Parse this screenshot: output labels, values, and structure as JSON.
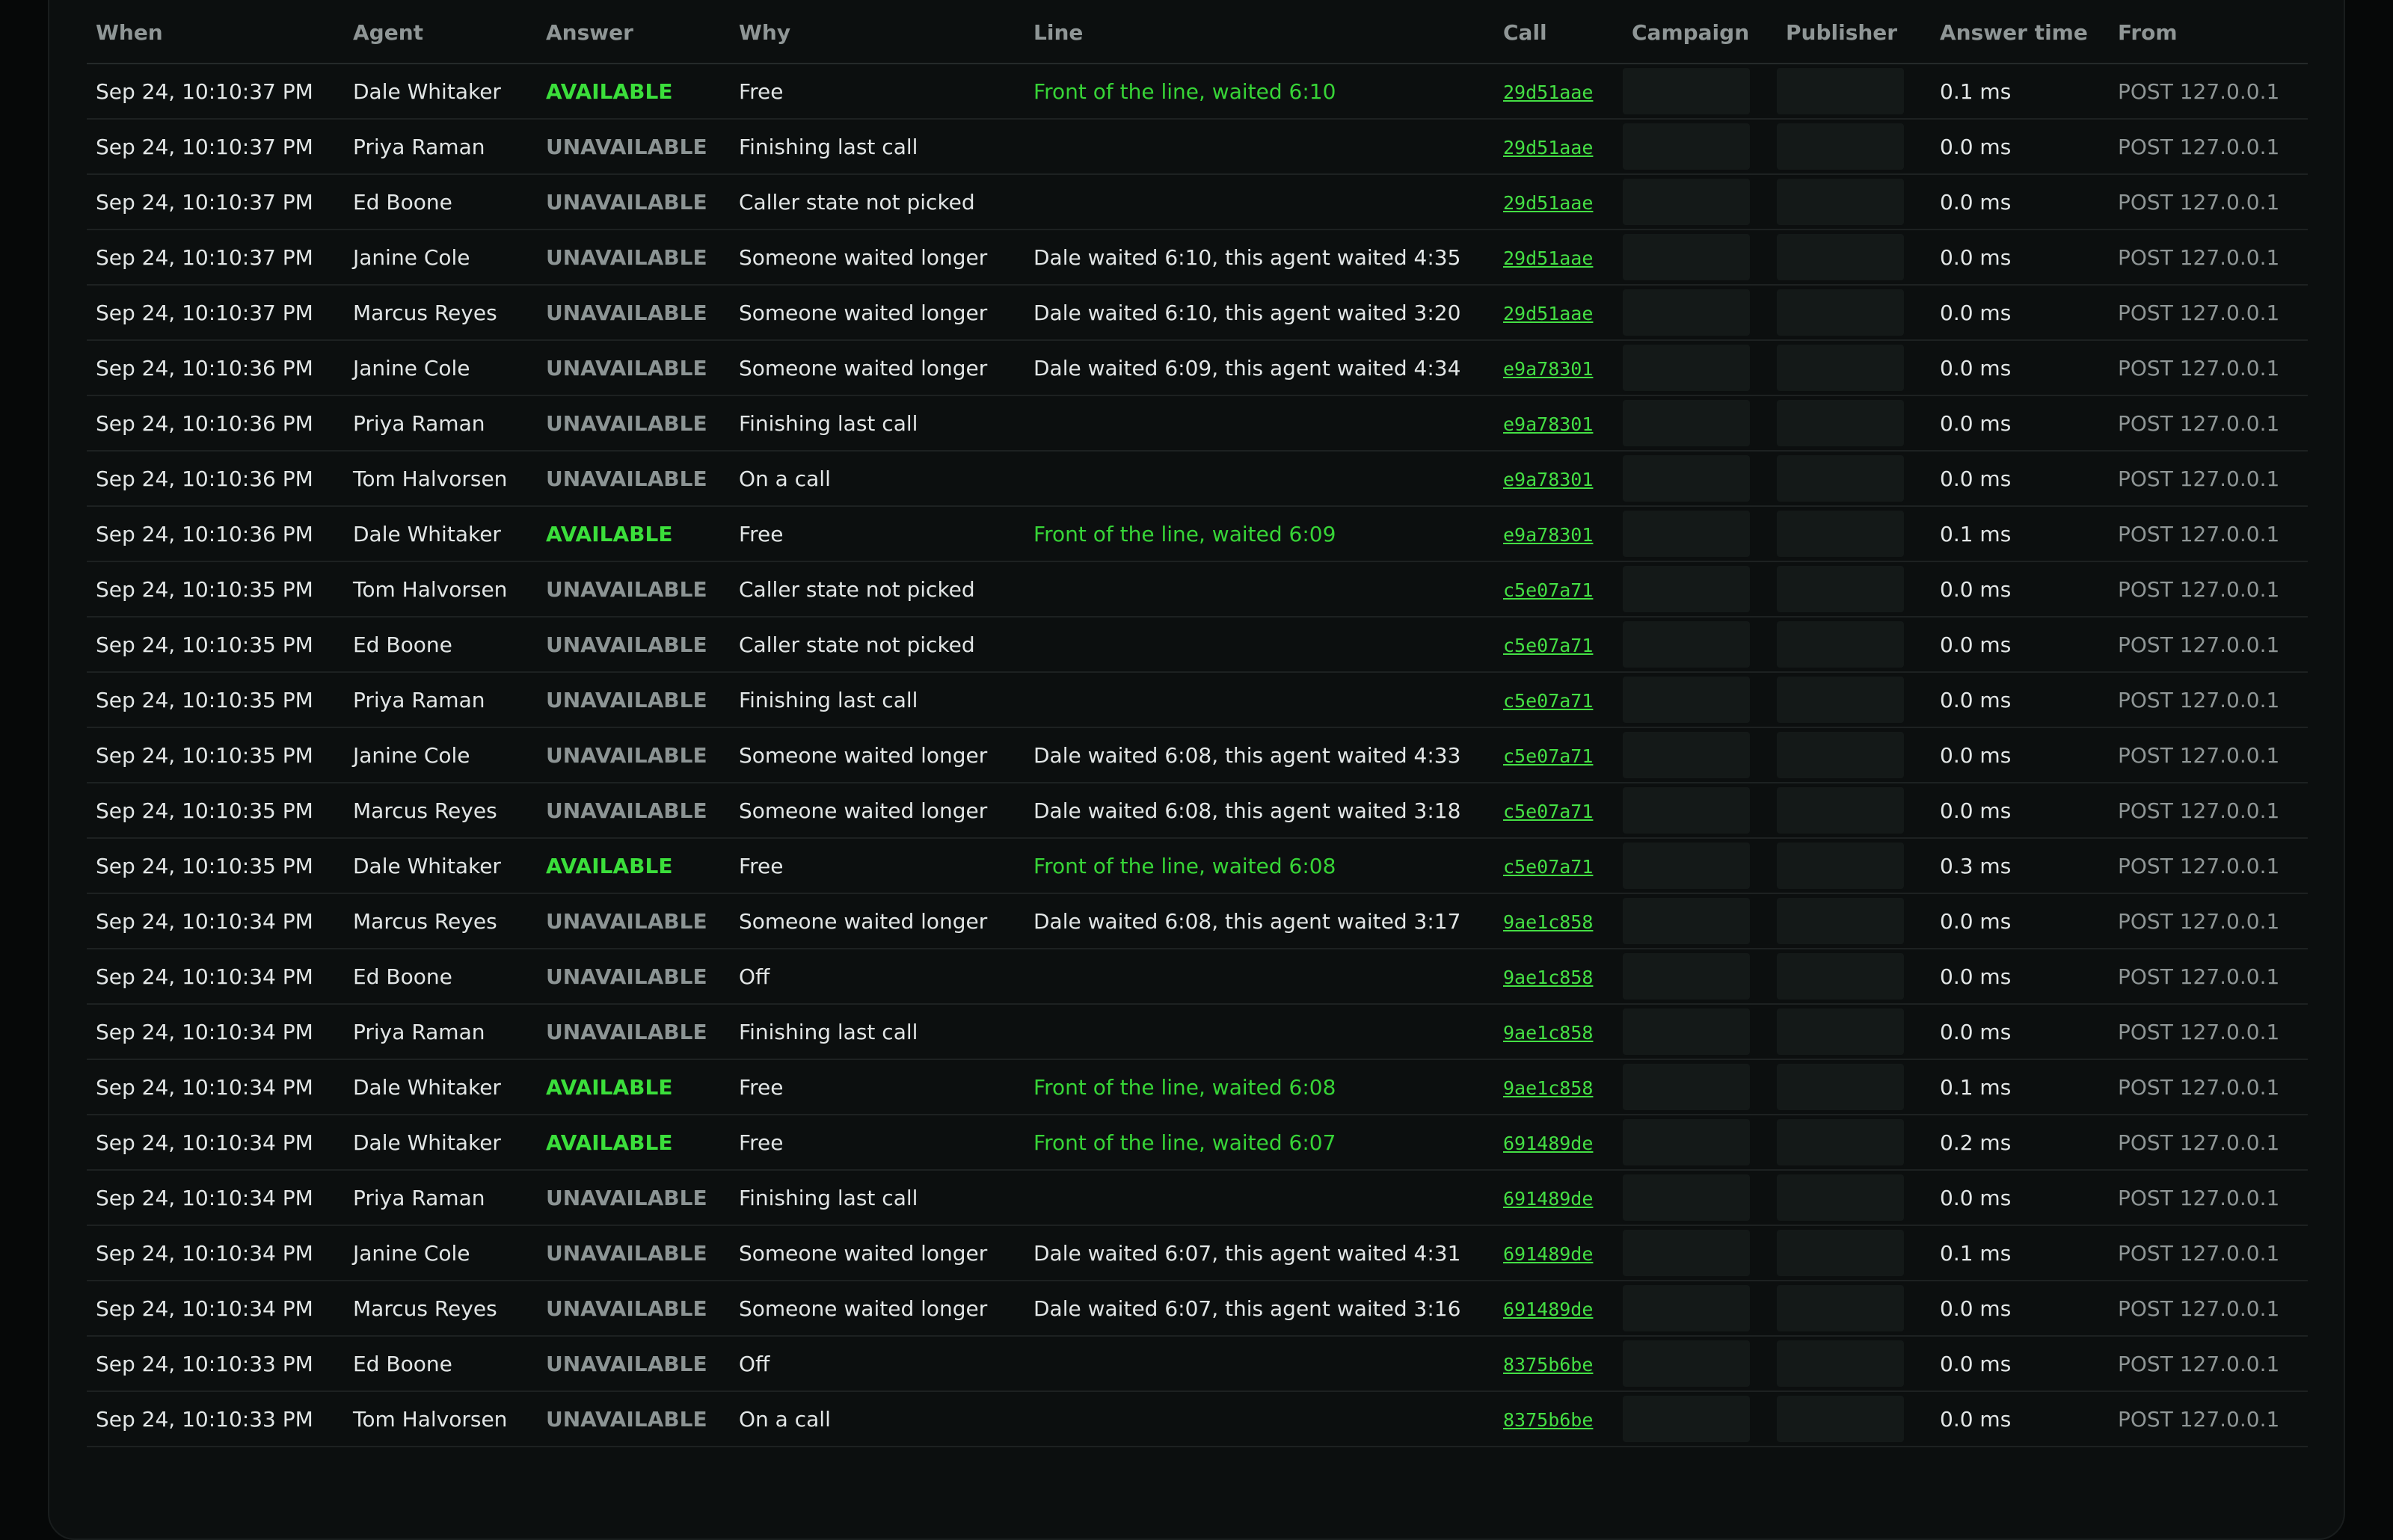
{
  "table": {
    "headers": [
      "When",
      "Agent",
      "Answer",
      "Why",
      "Line",
      "Call",
      "Campaign",
      "Publisher",
      "Answer time",
      "From"
    ],
    "rows": [
      {
        "when": "Sep 24, 10:10:37 PM",
        "agent": "Dale Whitaker",
        "answer": "AVAILABLE",
        "why": "Free",
        "line": "Front of the line, waited 6:10",
        "call": "29d51aae",
        "answer_time": "0.1 ms",
        "from": "POST 127.0.0.1"
      },
      {
        "when": "Sep 24, 10:10:37 PM",
        "agent": "Priya Raman",
        "answer": "UNAVAILABLE",
        "why": "Finishing last call",
        "line": "",
        "call": "29d51aae",
        "answer_time": "0.0 ms",
        "from": "POST 127.0.0.1"
      },
      {
        "when": "Sep 24, 10:10:37 PM",
        "agent": "Ed Boone",
        "answer": "UNAVAILABLE",
        "why": "Caller state not picked",
        "line": "",
        "call": "29d51aae",
        "answer_time": "0.0 ms",
        "from": "POST 127.0.0.1"
      },
      {
        "when": "Sep 24, 10:10:37 PM",
        "agent": "Janine Cole",
        "answer": "UNAVAILABLE",
        "why": "Someone waited longer",
        "line": "Dale waited 6:10, this agent waited 4:35",
        "call": "29d51aae",
        "answer_time": "0.0 ms",
        "from": "POST 127.0.0.1"
      },
      {
        "when": "Sep 24, 10:10:37 PM",
        "agent": "Marcus Reyes",
        "answer": "UNAVAILABLE",
        "why": "Someone waited longer",
        "line": "Dale waited 6:10, this agent waited 3:20",
        "call": "29d51aae",
        "answer_time": "0.0 ms",
        "from": "POST 127.0.0.1"
      },
      {
        "when": "Sep 24, 10:10:36 PM",
        "agent": "Janine Cole",
        "answer": "UNAVAILABLE",
        "why": "Someone waited longer",
        "line": "Dale waited 6:09, this agent waited 4:34",
        "call": "e9a78301",
        "answer_time": "0.0 ms",
        "from": "POST 127.0.0.1"
      },
      {
        "when": "Sep 24, 10:10:36 PM",
        "agent": "Priya Raman",
        "answer": "UNAVAILABLE",
        "why": "Finishing last call",
        "line": "",
        "call": "e9a78301",
        "answer_time": "0.0 ms",
        "from": "POST 127.0.0.1"
      },
      {
        "when": "Sep 24, 10:10:36 PM",
        "agent": "Tom Halvorsen",
        "answer": "UNAVAILABLE",
        "why": "On a call",
        "line": "",
        "call": "e9a78301",
        "answer_time": "0.0 ms",
        "from": "POST 127.0.0.1"
      },
      {
        "when": "Sep 24, 10:10:36 PM",
        "agent": "Dale Whitaker",
        "answer": "AVAILABLE",
        "why": "Free",
        "line": "Front of the line, waited 6:09",
        "call": "e9a78301",
        "answer_time": "0.1 ms",
        "from": "POST 127.0.0.1"
      },
      {
        "when": "Sep 24, 10:10:35 PM",
        "agent": "Tom Halvorsen",
        "answer": "UNAVAILABLE",
        "why": "Caller state not picked",
        "line": "",
        "call": "c5e07a71",
        "answer_time": "0.0 ms",
        "from": "POST 127.0.0.1"
      },
      {
        "when": "Sep 24, 10:10:35 PM",
        "agent": "Ed Boone",
        "answer": "UNAVAILABLE",
        "why": "Caller state not picked",
        "line": "",
        "call": "c5e07a71",
        "answer_time": "0.0 ms",
        "from": "POST 127.0.0.1"
      },
      {
        "when": "Sep 24, 10:10:35 PM",
        "agent": "Priya Raman",
        "answer": "UNAVAILABLE",
        "why": "Finishing last call",
        "line": "",
        "call": "c5e07a71",
        "answer_time": "0.0 ms",
        "from": "POST 127.0.0.1"
      },
      {
        "when": "Sep 24, 10:10:35 PM",
        "agent": "Janine Cole",
        "answer": "UNAVAILABLE",
        "why": "Someone waited longer",
        "line": "Dale waited 6:08, this agent waited 4:33",
        "call": "c5e07a71",
        "answer_time": "0.0 ms",
        "from": "POST 127.0.0.1"
      },
      {
        "when": "Sep 24, 10:10:35 PM",
        "agent": "Marcus Reyes",
        "answer": "UNAVAILABLE",
        "why": "Someone waited longer",
        "line": "Dale waited 6:08, this agent waited 3:18",
        "call": "c5e07a71",
        "answer_time": "0.0 ms",
        "from": "POST 127.0.0.1"
      },
      {
        "when": "Sep 24, 10:10:35 PM",
        "agent": "Dale Whitaker",
        "answer": "AVAILABLE",
        "why": "Free",
        "line": "Front of the line, waited 6:08",
        "call": "c5e07a71",
        "answer_time": "0.3 ms",
        "from": "POST 127.0.0.1"
      },
      {
        "when": "Sep 24, 10:10:34 PM",
        "agent": "Marcus Reyes",
        "answer": "UNAVAILABLE",
        "why": "Someone waited longer",
        "line": "Dale waited 6:08, this agent waited 3:17",
        "call": "9ae1c858",
        "answer_time": "0.0 ms",
        "from": "POST 127.0.0.1"
      },
      {
        "when": "Sep 24, 10:10:34 PM",
        "agent": "Ed Boone",
        "answer": "UNAVAILABLE",
        "why": "Off",
        "line": "",
        "call": "9ae1c858",
        "answer_time": "0.0 ms",
        "from": "POST 127.0.0.1"
      },
      {
        "when": "Sep 24, 10:10:34 PM",
        "agent": "Priya Raman",
        "answer": "UNAVAILABLE",
        "why": "Finishing last call",
        "line": "",
        "call": "9ae1c858",
        "answer_time": "0.0 ms",
        "from": "POST 127.0.0.1"
      },
      {
        "when": "Sep 24, 10:10:34 PM",
        "agent": "Dale Whitaker",
        "answer": "AVAILABLE",
        "why": "Free",
        "line": "Front of the line, waited 6:08",
        "call": "9ae1c858",
        "answer_time": "0.1 ms",
        "from": "POST 127.0.0.1"
      },
      {
        "when": "Sep 24, 10:10:34 PM",
        "agent": "Dale Whitaker",
        "answer": "AVAILABLE",
        "why": "Free",
        "line": "Front of the line, waited 6:07",
        "call": "691489de",
        "answer_time": "0.2 ms",
        "from": "POST 127.0.0.1"
      },
      {
        "when": "Sep 24, 10:10:34 PM",
        "agent": "Priya Raman",
        "answer": "UNAVAILABLE",
        "why": "Finishing last call",
        "line": "",
        "call": "691489de",
        "answer_time": "0.0 ms",
        "from": "POST 127.0.0.1"
      },
      {
        "when": "Sep 24, 10:10:34 PM",
        "agent": "Janine Cole",
        "answer": "UNAVAILABLE",
        "why": "Someone waited longer",
        "line": "Dale waited 6:07, this agent waited 4:31",
        "call": "691489de",
        "answer_time": "0.1 ms",
        "from": "POST 127.0.0.1"
      },
      {
        "when": "Sep 24, 10:10:34 PM",
        "agent": "Marcus Reyes",
        "answer": "UNAVAILABLE",
        "why": "Someone waited longer",
        "line": "Dale waited 6:07, this agent waited 3:16",
        "call": "691489de",
        "answer_time": "0.0 ms",
        "from": "POST 127.0.0.1"
      },
      {
        "when": "Sep 24, 10:10:33 PM",
        "agent": "Ed Boone",
        "answer": "UNAVAILABLE",
        "why": "Off",
        "line": "",
        "call": "8375b6be",
        "answer_time": "0.0 ms",
        "from": "POST 127.0.0.1"
      },
      {
        "when": "Sep 24, 10:10:33 PM",
        "agent": "Tom Halvorsen",
        "answer": "UNAVAILABLE",
        "why": "On a call",
        "line": "",
        "call": "8375b6be",
        "answer_time": "0.0 ms",
        "from": "POST 127.0.0.1"
      }
    ]
  },
  "colors": {
    "available": "#3bdf3b",
    "unavailable": "#8c9494",
    "link": "#44df44",
    "background": "#060808",
    "panel": "#0c0f0f"
  }
}
